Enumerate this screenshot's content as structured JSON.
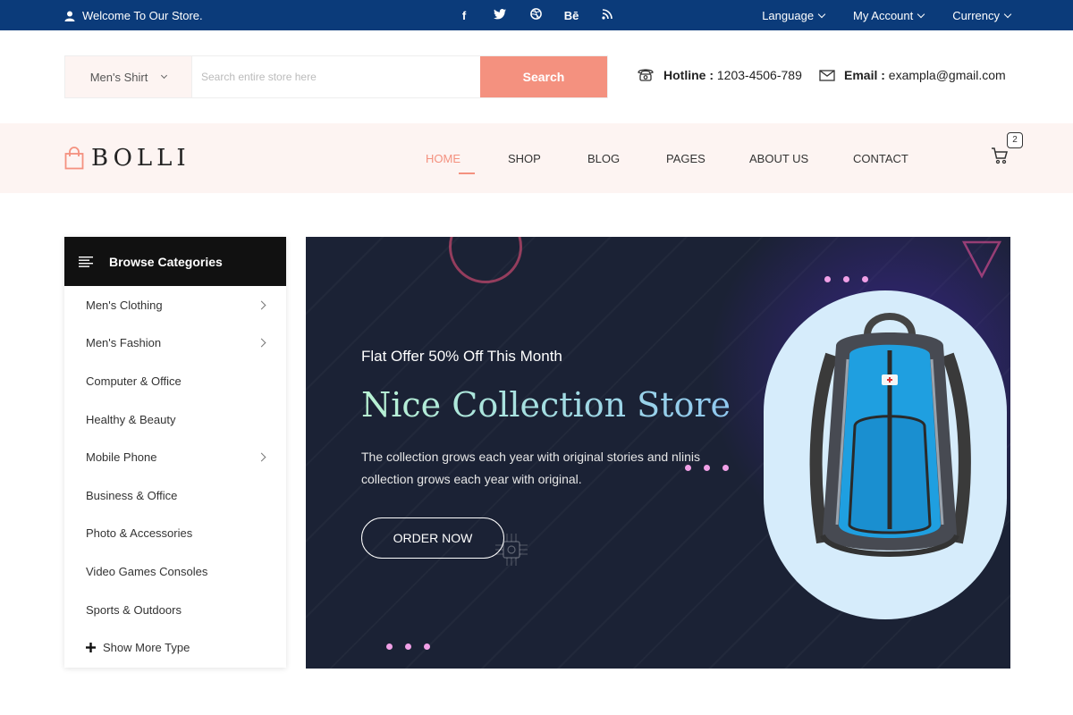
{
  "topbar": {
    "welcome": "Welcome To Our Store.",
    "social_icons": [
      "facebook-icon",
      "twitter-icon",
      "dribbble-icon",
      "behance-icon",
      "rss-icon"
    ],
    "behance_label": "Bē",
    "language": "Language",
    "account": "My Account",
    "currency": "Currency"
  },
  "search": {
    "category_value": "Men's Shirt",
    "placeholder": "Search entire store here",
    "button": "Search"
  },
  "contact": {
    "hotline_label": "Hotline :",
    "hotline_value": "1203-4506-789",
    "email_label": "Email :",
    "email_value": "exampla@gmail.com"
  },
  "brand": {
    "logo_text": "BOLLI"
  },
  "nav": {
    "items": [
      "HOME",
      "SHOP",
      "BLOG",
      "PAGES",
      "ABOUT US",
      "CONTACT"
    ],
    "active_index": 0,
    "cart_count": "2"
  },
  "sidebar": {
    "title": "Browse Categories",
    "items": [
      {
        "label": "Men's Clothing",
        "has_sub": true
      },
      {
        "label": "Men's Fashion",
        "has_sub": true
      },
      {
        "label": "Computer & Office",
        "has_sub": false
      },
      {
        "label": "Healthy & Beauty",
        "has_sub": false
      },
      {
        "label": "Mobile Phone",
        "has_sub": true
      },
      {
        "label": "Business & Office",
        "has_sub": false
      },
      {
        "label": "Photo & Accessories",
        "has_sub": false
      },
      {
        "label": "Video Games Consoles",
        "has_sub": false
      },
      {
        "label": "Sports & Outdoors",
        "has_sub": false
      }
    ],
    "show_more": "Show More Type"
  },
  "hero": {
    "offer": "Flat Offer 50% Off This Month",
    "title": "Nice Collection Store",
    "description": "The collection grows each year with original stories and nlinis collection grows each year with original.",
    "button": "ORDER NOW"
  },
  "colors": {
    "topbar": "#0b3b7a",
    "accent": "#f4917f",
    "nav_bg": "#fdf4f2",
    "hero_bg": "#1b2235"
  }
}
